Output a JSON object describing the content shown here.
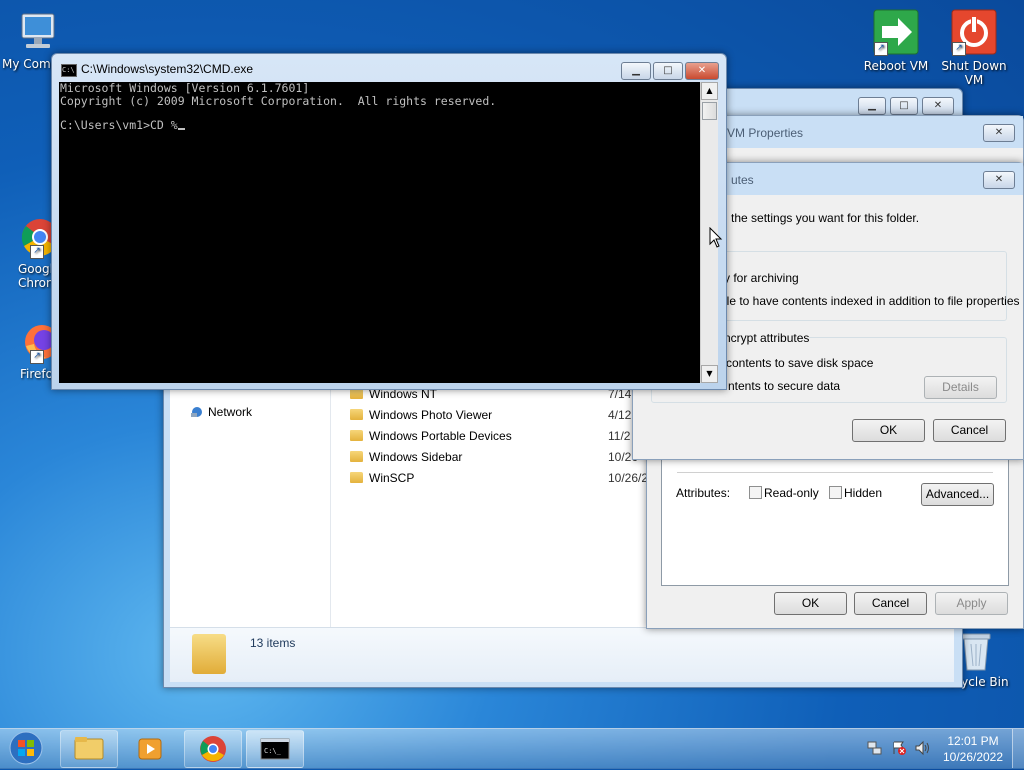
{
  "desktop": {
    "icons": {
      "my_computer": "My Comp",
      "chrome_line1": "Googl",
      "chrome_line2": "Chron",
      "firefox": "Firefo",
      "reboot": "Reboot VM",
      "shutdown_line1": "Shut Down",
      "shutdown_line2": "VM",
      "recycle": "Recycle Bin"
    }
  },
  "cmd": {
    "title": "C:\\Windows\\system32\\CMD.exe",
    "line1": "Microsoft Windows [Version 6.1.7601]",
    "line2": "Copyright (c) 2009 Microsoft Corporation.  All rights reserved.",
    "prompt": "C:\\Users\\vm1>CD %"
  },
  "explorer": {
    "nav_network": "Network",
    "files": [
      {
        "name": "Windows NT",
        "date": "7/14"
      },
      {
        "name": "Windows Photo Viewer",
        "date": "4/12"
      },
      {
        "name": "Windows Portable Devices",
        "date": "11/2"
      },
      {
        "name": "Windows Sidebar",
        "date": "10/26"
      },
      {
        "name": "WinSCP",
        "date": "10/26/2"
      }
    ],
    "status": "13 items"
  },
  "properties": {
    "title": "n VM Properties",
    "attributes_label": "Attributes:",
    "readonly": "Read-only",
    "hidden": "Hidden",
    "advanced": "Advanced...",
    "ok": "OK",
    "cancel": "Cancel",
    "apply": "Apply"
  },
  "advanced": {
    "title": "utes",
    "intro": "the settings you want for this folder.",
    "archive": "y for archiving",
    "index": "ile to have contents indexed in addition to file properties",
    "compress_group": "ncrypt attributes",
    "compress": "contents to save disk space",
    "encrypt": "ntents to secure data",
    "details": "Details",
    "ok": "OK",
    "cancel": "Cancel"
  },
  "taskbar": {
    "time": "12:01 PM",
    "date": "10/26/2022"
  }
}
